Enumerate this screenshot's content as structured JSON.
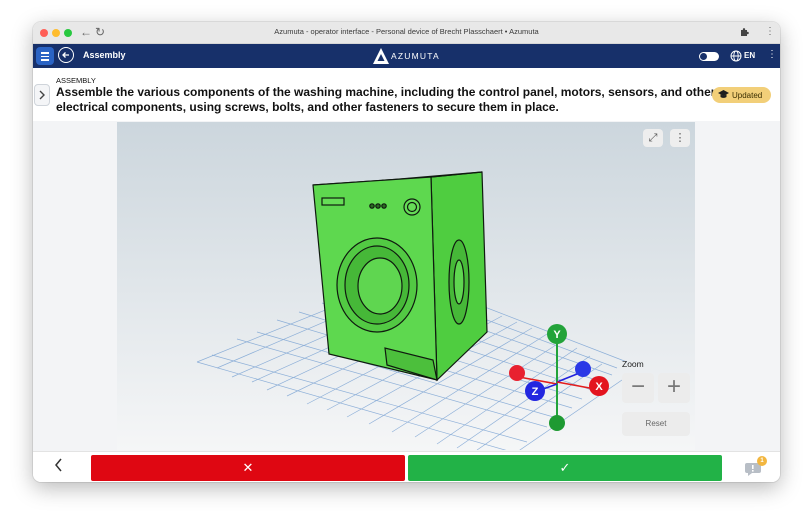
{
  "browser": {
    "window_title": "Azumuta - operator interface - Personal device of Brecht Plasschaert • Azumuta",
    "traffic_lights": [
      "#ff5f57",
      "#febc2e",
      "#28c840"
    ]
  },
  "appbar": {
    "module": "Assembly",
    "brand": "AZUMUTA",
    "language": "EN",
    "color": "#17306a"
  },
  "step": {
    "label": "ASSEMBLY",
    "instruction": "Assemble the various components of the washing machine, including the control panel, motors, sensors, and other electrical components, using screws, bolts, and other fasteners to secure them in place.",
    "badge": "Updated",
    "badge_color": "#f2cf79"
  },
  "viewer": {
    "axes": {
      "y": "Y",
      "x": "X",
      "z": "Z"
    },
    "model_color": "#5ed84f",
    "zoom_label": "Zoom",
    "zoom_out": "−",
    "zoom_in": "+",
    "reset": "Reset"
  },
  "actions": {
    "reject_symbol": "✕",
    "accept_symbol": "✓",
    "reject_color": "#df0712",
    "accept_color": "#22b247",
    "notifications": "1"
  }
}
